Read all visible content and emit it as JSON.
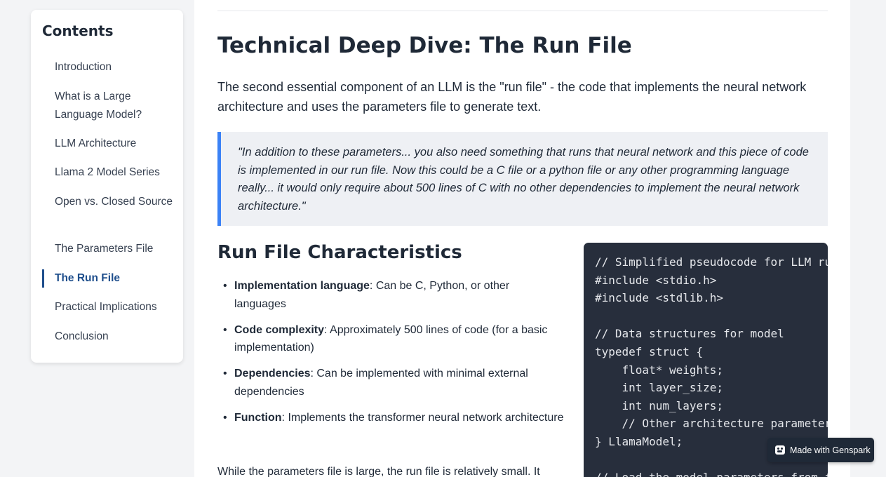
{
  "sidebar": {
    "title": "Contents",
    "items": [
      {
        "label": "Introduction"
      },
      {
        "label": "What is a Large Language Model?"
      },
      {
        "label": "LLM Architecture"
      },
      {
        "label": "Llama 2 Model Series"
      },
      {
        "label": "Open vs. Closed Source"
      },
      {
        "label": "The Parameters File"
      },
      {
        "label": "The Run File",
        "active": true
      },
      {
        "label": "Practical Implications"
      },
      {
        "label": "Conclusion"
      }
    ]
  },
  "main": {
    "title": "Technical Deep Dive: The Run File",
    "intro": "The second essential component of an LLM is the \"run file\" - the code that implements the neural network architecture and uses the parameters file to generate text.",
    "quote": "\"In addition to these parameters... you also need something that runs that neural network and this piece of code is implemented in our run file. Now this could be a C file or a python file or any other programming language really... it would only require about 500 lines of C with no other dependencies to implement the neural network architecture.\"",
    "section_title": "Run File Characteristics",
    "features": [
      {
        "term": "Implementation language",
        "desc": ": Can be C, Python, or other languages"
      },
      {
        "term": "Code complexity",
        "desc": ": Approximately 500 lines of code (for a basic implementation)"
      },
      {
        "term": "Dependencies",
        "desc": ": Can be implemented with minimal external dependencies"
      },
      {
        "term": "Function",
        "desc": ": Implements the transformer neural network architecture"
      }
    ],
    "outro": "While the parameters file is large, the run file is relatively small. It",
    "code_lines": [
      "// Simplified pseudocode for LLM run file",
      "#include <stdio.h>",
      "#include <stdlib.h>",
      "",
      "// Data structures for model",
      "typedef struct {",
      "    float* weights;",
      "    int layer_size;",
      "    int num_layers;",
      "    // Other architecture parameters",
      "} LlamaModel;",
      "",
      "// Load the model parameters from file"
    ]
  },
  "badge": {
    "label": "Made with Genspark"
  }
}
